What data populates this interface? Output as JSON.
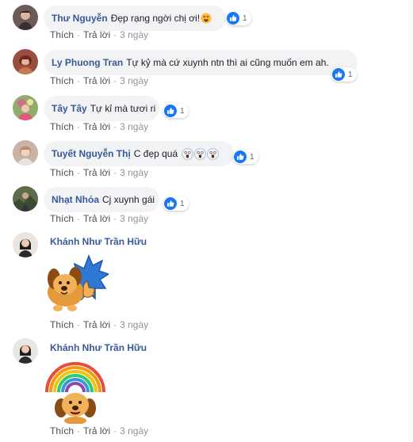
{
  "comments": [
    {
      "author": "Thư Nguyễn",
      "text": "Đẹp rạng ngời chị ơi!",
      "emoji": "heart-eyes-face",
      "reactions": "1",
      "actions": {
        "like": "Thích",
        "reply": "Trả lời",
        "time": "3 ngày"
      }
    },
    {
      "author": "Ly Phuong Tran",
      "text": "Tự kỷ mà cứ xuynh ntn thì ai cũng muốn em ah.",
      "reactions": "1",
      "actions": {
        "like": "Thích",
        "reply": "Trả lời",
        "time": "3 ngày"
      }
    },
    {
      "author": "Tây Tây",
      "text": "Tự kỉ mà tươi ri",
      "reactions": "1",
      "actions": {
        "like": "Thích",
        "reply": "Trả lời",
        "time": "3 ngày"
      }
    },
    {
      "author": "Tuyết Nguyễn Thị",
      "text": "C đẹp quá",
      "emoji": "screaming-face x3",
      "reactions": "1",
      "actions": {
        "like": "Thích",
        "reply": "Trả lời",
        "time": "3 ngày"
      }
    },
    {
      "author": "Nhạt Nhỏa",
      "text": "Cj xuynh gái",
      "reactions": "1",
      "actions": {
        "like": "Thích",
        "reply": "Trả lời",
        "time": "3 ngày"
      }
    },
    {
      "author": "Khánh Như Trần Hữu",
      "sticker": "dog-thumbs-up-sticker",
      "actions": {
        "like": "Thích",
        "reply": "Trả lời",
        "time": "3 ngày"
      }
    },
    {
      "author": "Khánh Như Trần Hữu",
      "sticker": "dog-rainbow-sticker",
      "actions": {
        "like": "Thích",
        "reply": "Trả lời",
        "time": "3 ngày"
      }
    }
  ],
  "colors": {
    "author": "#385898",
    "bubble": "#f2f3f5",
    "like_blue": "#1877f2",
    "meta": "#90949c"
  }
}
